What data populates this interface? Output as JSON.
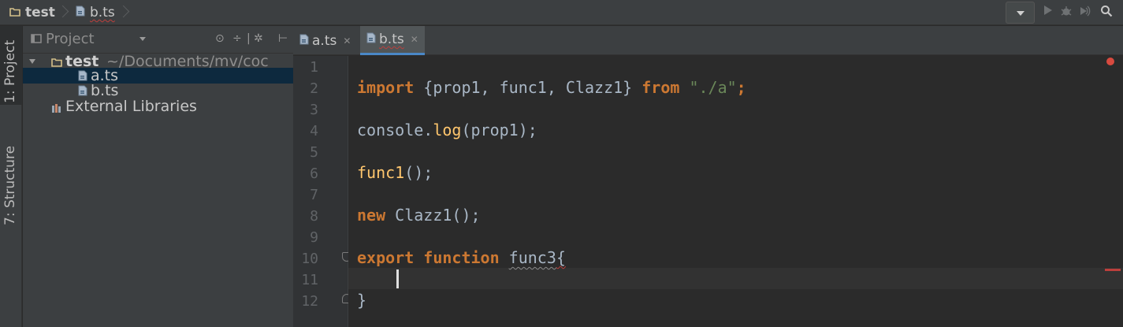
{
  "navbar": {
    "project_crumb": "test",
    "file_crumb": "b.ts"
  },
  "left_strip": {
    "project_tab": "1: Project",
    "structure_tab": "7: Structure"
  },
  "project_panel": {
    "title": "Project",
    "tree": {
      "root_name": "test",
      "root_path": "~/Documents/mv/coc",
      "files": [
        "a.ts",
        "b.ts"
      ],
      "external": "External Libraries"
    }
  },
  "editor": {
    "tabs": [
      {
        "label": "a.ts",
        "active": false
      },
      {
        "label": "b.ts",
        "active": true
      }
    ],
    "line_numbers": [
      "1",
      "2",
      "3",
      "4",
      "5",
      "6",
      "7",
      "8",
      "9",
      "10",
      "11",
      "12"
    ],
    "code": {
      "l2_import": "import",
      "l2_names": " {prop1, func1, Clazz1} ",
      "l2_from": "from",
      "l2_str": "\"./a\"",
      "l2_semi": ";",
      "l4_obj": "console.",
      "l4_fn": "log",
      "l4_rest": "(prop1);",
      "l6_fn": "func1",
      "l6_rest": "();",
      "l8_new": "new",
      "l8_rest": " Clazz1();",
      "l10_export": "export",
      "l10_function": "function",
      "l10_name": "func3",
      "l10_brace": "{",
      "l12_brace": "}"
    },
    "caret_line": 11
  },
  "colors": {
    "keyword": "#cc7832",
    "string": "#6a8759",
    "function_call": "#ffc66d",
    "plain": "#a9b7c6",
    "selection": "#0d293e",
    "error": "#bc3f3c"
  }
}
